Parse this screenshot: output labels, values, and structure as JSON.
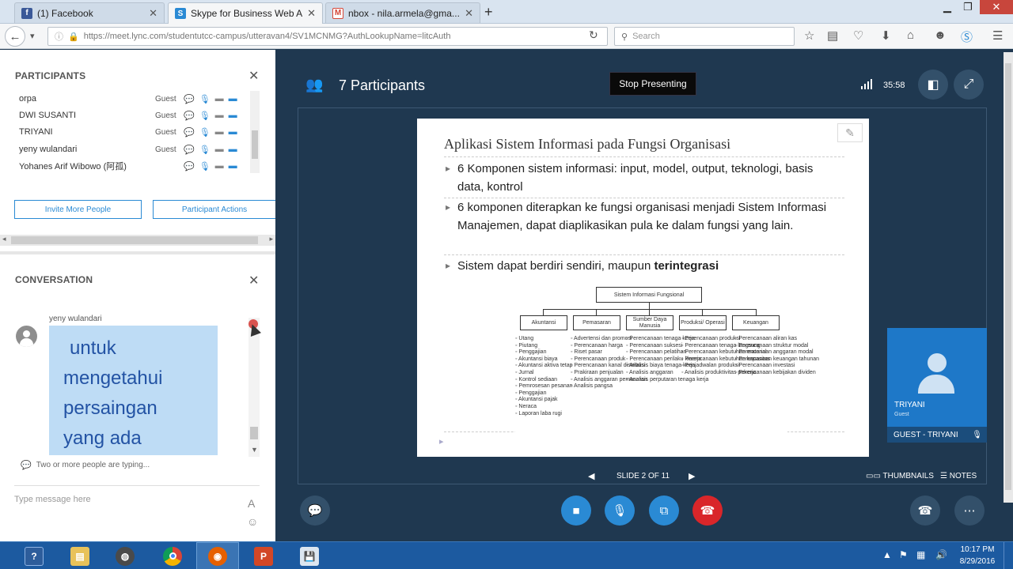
{
  "browser": {
    "tabs": [
      {
        "title": "(1) Facebook",
        "favicon": "facebook-icon",
        "color": "#3b5998"
      },
      {
        "title": "Skype for Business Web A...",
        "favicon": "skype-icon",
        "color": "#2a8ad4"
      },
      {
        "title": "nbox - nila.armela@gma...",
        "favicon": "gmail-icon",
        "color": "#d44638"
      }
    ],
    "url": "https://meet.lync.com/studentutcc-campus/utteravan4/SV1MCNMG?AuthLookupName=litcAuth",
    "search_placeholder": "Search"
  },
  "participants": {
    "title": "PARTICIPANTS",
    "list": [
      {
        "name": "orpa",
        "role": "Guest"
      },
      {
        "name": "DWI SUSANTI",
        "role": "Guest"
      },
      {
        "name": "TRIYANI",
        "role": "Guest"
      },
      {
        "name": "yeny wulandari",
        "role": "Guest"
      },
      {
        "name": "Yohanes Arif Wibowo (阿孤)",
        "role": ""
      }
    ],
    "invite_label": "Invite More People",
    "actions_label": "Participant Actions"
  },
  "conversation": {
    "title": "CONVERSATION",
    "sender": "yeny wulandari",
    "message_lines": [
      "untuk",
      "mengetahui",
      "persaingan",
      "yang ada"
    ],
    "typing": "Two or more people are typing...",
    "input_placeholder": "Type message here"
  },
  "meeting": {
    "participant_count": "7 Participants",
    "stop_presenting": "Stop Presenting",
    "timer": "35:58",
    "slide_label": "SLIDE 2 OF 11",
    "thumbnails": "THUMBNAILS",
    "notes": "NOTES"
  },
  "slide": {
    "title": "Aplikasi Sistem Informasi pada Fungsi Organisasi",
    "bullets": [
      "6 Komponen sistem informasi: input, model, output, teknologi, basis data, kontrol",
      "6 komponen diterapkan ke fungsi organisasi menjadi Sistem Informasi Manajemen, dapat diaplikasikan pula ke dalam fungsi yang lain."
    ],
    "bullet3_plain": "Sistem dapat berdiri sendiri, maupun ",
    "bullet3_bold": "terintegrasi",
    "diagram": {
      "root": "Sistem Informasi Fungsional",
      "categories": [
        {
          "name": "Akuntansi",
          "items": [
            "Utang",
            "Piutang",
            "Penggajian",
            "Akuntansi biaya",
            "Akuntansi aktiva tetap",
            "Jurnal",
            "Kontrol sediaan",
            "Pemrosesan pesanan",
            "Penggajian",
            "Akuntansi pajak",
            "Neraca",
            "Laporan laba rugi"
          ]
        },
        {
          "name": "Pemasaran",
          "items": [
            "Advertensi dan promosi",
            "Perencanaan harga",
            "Riset pasar",
            "Perencanaan produk",
            "Perencanaan kanal distribusi",
            "Prakiraan penjualan",
            "Analisis anggaran pemasaran",
            "Analisis pangsa"
          ]
        },
        {
          "name": "Sumber Daya Manusia",
          "items": [
            "Perencanaan tenaga kerja",
            "Perencanaan suksesi",
            "Perencanaan pelatihan",
            "Perencanaan perilaku kinerja",
            "Analisis biaya tenaga kerja",
            "Analisis anggaran",
            "Analisis perputaran tenaga kerja"
          ]
        },
        {
          "name": "Produksi/ Operasi",
          "items": [
            "Perencanaan produksi",
            "Perencanaan tenaga langsung",
            "Perencanaan kebutuhan material",
            "Perencanaan kebutuhan kapasitas",
            "Penjadwalan produksi",
            "Analisis produktivitas pekerja"
          ]
        },
        {
          "name": "Keuangan",
          "items": [
            "Perencanaan aliran kas",
            "Perencanaan struktur modal",
            "Perencanaan anggaran modal",
            "Perencanaan keuangan tahunan",
            "Perencanaan investasi",
            "Perencanaan kebijakan dividen"
          ]
        }
      ]
    }
  },
  "video_tile": {
    "name": "TRIYANI",
    "role": "Guest",
    "label": "GUEST - TRIYANI"
  },
  "taskbar": {
    "time": "10:17 PM",
    "date": "8/29/2016"
  }
}
